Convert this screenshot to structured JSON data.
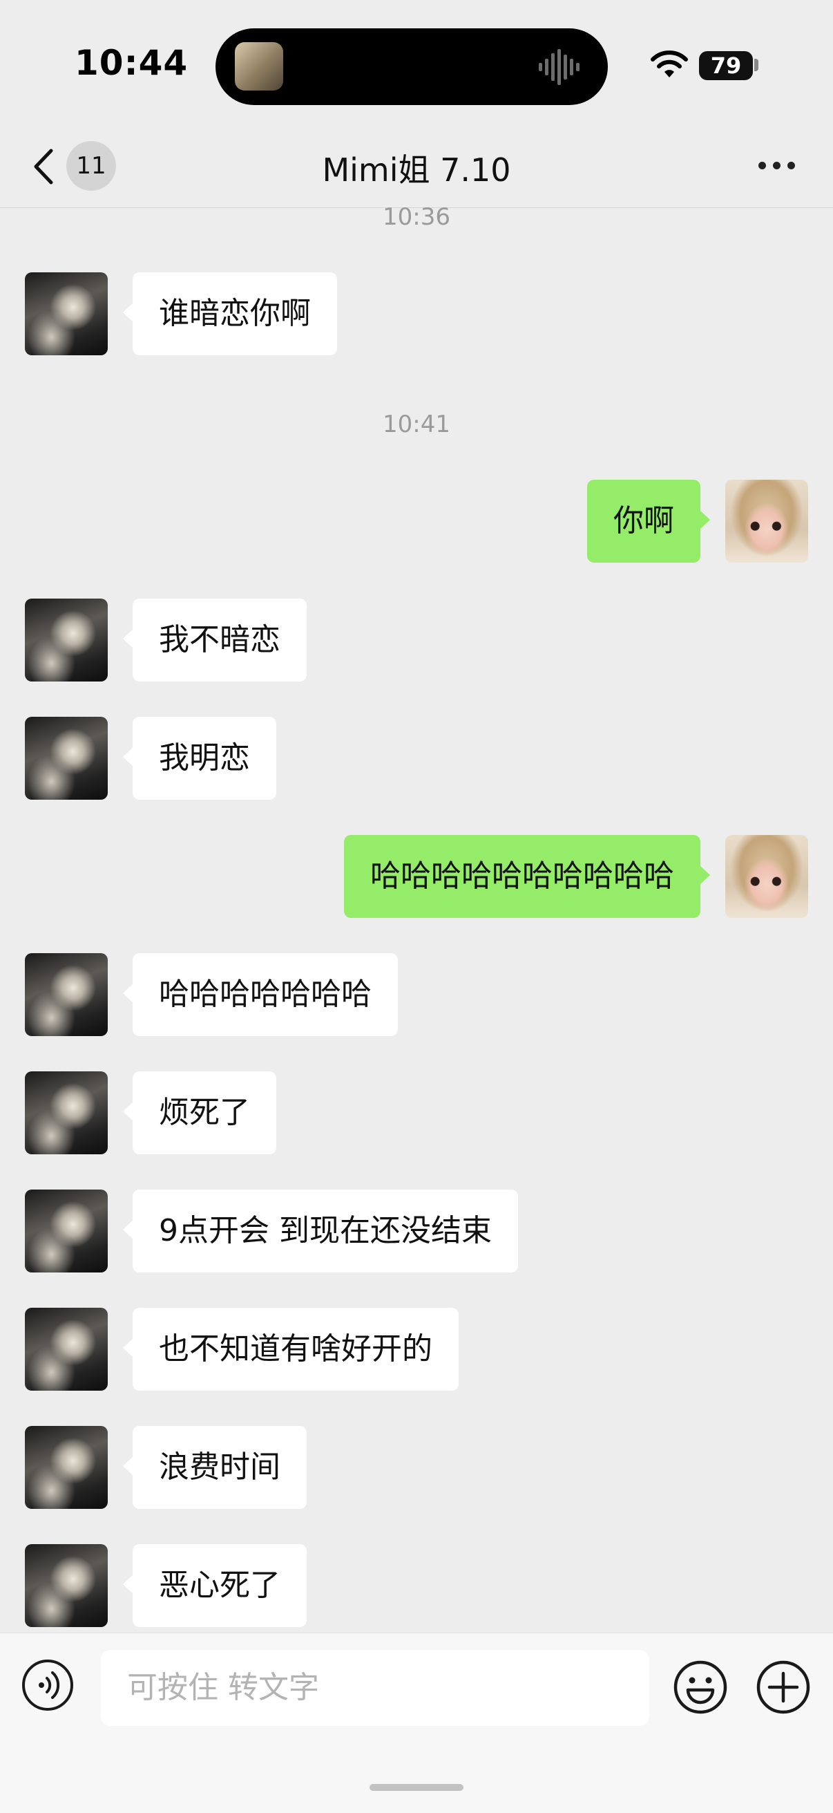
{
  "status_bar": {
    "time": "10:44",
    "battery": "79"
  },
  "nav": {
    "unread_count": "11",
    "title": "Mimi姐 7.10"
  },
  "timestamps": [
    "10:36",
    "10:41"
  ],
  "messages": [
    {
      "sender": "friend",
      "text": "谁暗恋你啊"
    },
    {
      "sender": "self",
      "text": "你啊"
    },
    {
      "sender": "friend",
      "text": "我不暗恋"
    },
    {
      "sender": "friend",
      "text": "我明恋"
    },
    {
      "sender": "self",
      "text": "哈哈哈哈哈哈哈哈哈哈"
    },
    {
      "sender": "friend",
      "text": "哈哈哈哈哈哈哈"
    },
    {
      "sender": "friend",
      "text": "烦死了"
    },
    {
      "sender": "friend",
      "text": "9点开会 到现在还没结束"
    },
    {
      "sender": "friend",
      "text": "也不知道有啥好开的"
    },
    {
      "sender": "friend",
      "text": "浪费时间"
    },
    {
      "sender": "friend",
      "text": "恶心死了"
    }
  ],
  "input": {
    "placeholder": "可按住 转文字"
  },
  "colors": {
    "background": "#ededed",
    "self_bubble": "#95ec69",
    "friend_bubble": "#ffffff"
  },
  "icons": [
    "chevron-left-icon",
    "more-dots-icon",
    "voice-icon",
    "emoji-icon",
    "plus-icon",
    "wifi-icon",
    "battery-icon"
  ]
}
